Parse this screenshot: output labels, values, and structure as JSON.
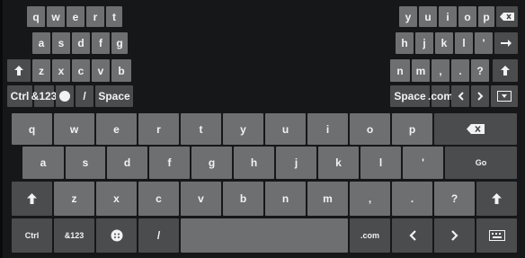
{
  "keyboard": {
    "split": {
      "left": {
        "row1": [
          "q",
          "w",
          "e",
          "r",
          "t"
        ],
        "row2": [
          "a",
          "s",
          "d",
          "f",
          "g"
        ],
        "row3_keys": [
          "z",
          "x",
          "c",
          "v",
          "b"
        ],
        "row4": {
          "ctrl": "Ctrl",
          "sym": "&123",
          "slash": "/",
          "space": "Space"
        }
      },
      "right": {
        "row1": [
          "y",
          "u",
          "i",
          "o",
          "p"
        ],
        "row2": [
          "h",
          "j",
          "k",
          "l",
          "'"
        ],
        "row3": [
          "n",
          "m",
          ",",
          ".",
          "?"
        ],
        "row4": {
          "space": "Space",
          "dotcom": ".com"
        }
      }
    },
    "full": {
      "row1": [
        "q",
        "w",
        "e",
        "r",
        "t",
        "y",
        "u",
        "i",
        "o",
        "p"
      ],
      "row2": [
        "a",
        "s",
        "d",
        "f",
        "g",
        "h",
        "j",
        "k",
        "l",
        "'"
      ],
      "go": "Go",
      "row3": [
        "z",
        "x",
        "c",
        "v",
        "b",
        "n",
        "m",
        ",",
        ".",
        "?"
      ],
      "row4": {
        "ctrl": "Ctrl",
        "sym": "&123",
        "slash": "/",
        "dotcom": ".com"
      }
    },
    "colors": {
      "key": "#6d6f71",
      "key_dark": "#4a4c4e",
      "background": "#161718",
      "text": "#f2f2f2"
    }
  }
}
